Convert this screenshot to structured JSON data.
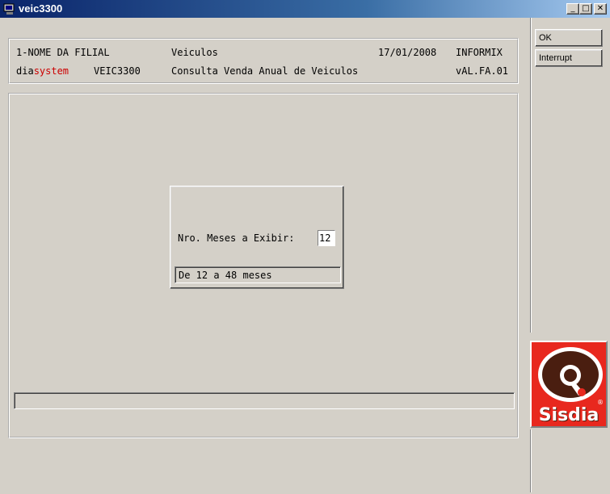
{
  "window": {
    "title": "veic3300"
  },
  "header": {
    "branch": "1-NOME DA FILIAL",
    "module": "Veiculos",
    "date": "17/01/2008",
    "db": "INFORMIX",
    "brand_prefix": "dia",
    "brand_suffix": "system",
    "program": "VEIC3300",
    "description": "Consulta Venda Anual de Veiculos",
    "version": "vAL.FA.01"
  },
  "dialog": {
    "label": "Nro. Meses a Exibir:",
    "value": "12",
    "hint": "De 12 a 48 meses"
  },
  "side": {
    "ok": "OK",
    "interrupt": "Interrupt"
  },
  "logo": {
    "text": "Sisdia"
  },
  "colors": {
    "brand_red": "#cc0000",
    "logo_bg": "#e8281e",
    "logo_brown": "#4a1e10"
  }
}
